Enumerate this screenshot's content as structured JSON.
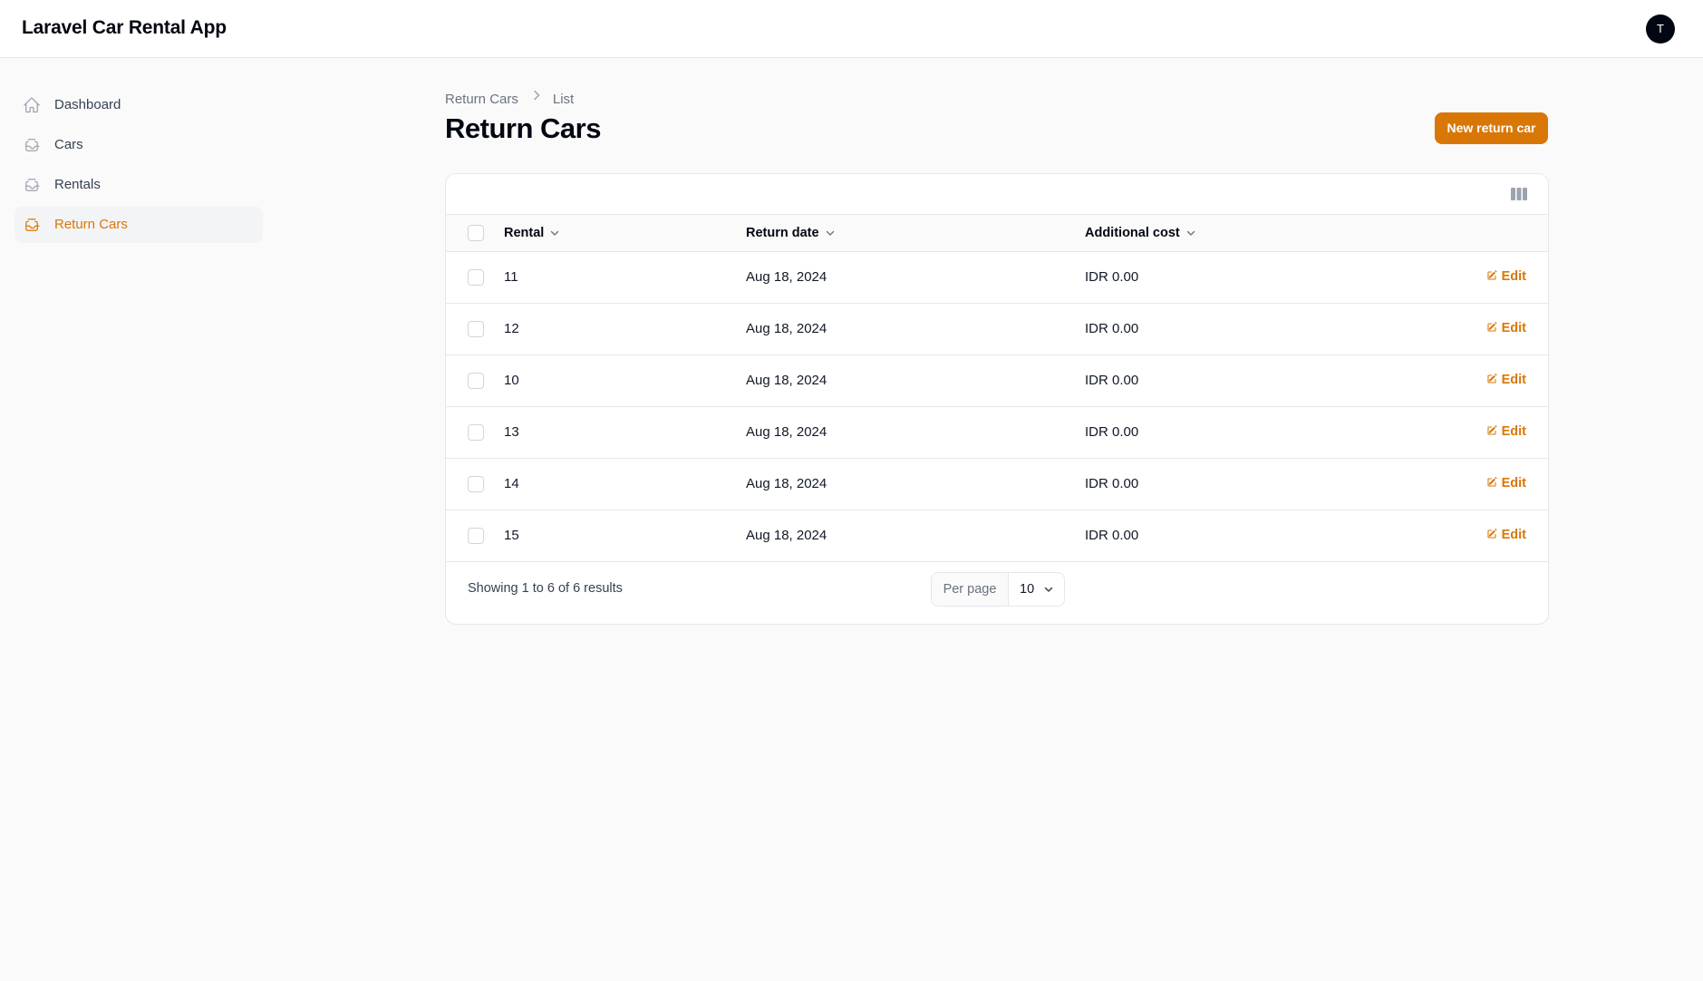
{
  "app": {
    "title": "Laravel Car Rental App",
    "user_initial": "T"
  },
  "sidebar": {
    "items": [
      {
        "label": "Dashboard",
        "icon": "home-icon",
        "active": false
      },
      {
        "label": "Cars",
        "icon": "inbox-stack-icon",
        "active": false
      },
      {
        "label": "Rentals",
        "icon": "inbox-stack-icon",
        "active": false
      },
      {
        "label": "Return Cars",
        "icon": "inbox-stack-icon",
        "active": true
      }
    ]
  },
  "breadcrumb": {
    "parent": "Return Cars",
    "current": "List"
  },
  "page": {
    "title": "Return Cars",
    "new_button": "New return car"
  },
  "table": {
    "columns": [
      "Rental",
      "Return date",
      "Additional cost"
    ],
    "edit_label": "Edit",
    "rows": [
      {
        "rental": "11",
        "return_date": "Aug 18, 2024",
        "additional_cost": "IDR 0.00"
      },
      {
        "rental": "12",
        "return_date": "Aug 18, 2024",
        "additional_cost": "IDR 0.00"
      },
      {
        "rental": "10",
        "return_date": "Aug 18, 2024",
        "additional_cost": "IDR 0.00"
      },
      {
        "rental": "13",
        "return_date": "Aug 18, 2024",
        "additional_cost": "IDR 0.00"
      },
      {
        "rental": "14",
        "return_date": "Aug 18, 2024",
        "additional_cost": "IDR 0.00"
      },
      {
        "rental": "15",
        "return_date": "Aug 18, 2024",
        "additional_cost": "IDR 0.00"
      }
    ]
  },
  "pagination": {
    "results_text": "Showing 1 to 6 of 6 results",
    "per_page_label": "Per page",
    "per_page_value": "10"
  },
  "colors": {
    "accent": "#d97706",
    "active_bg": "#f3f4f6",
    "border": "#e5e7eb"
  }
}
